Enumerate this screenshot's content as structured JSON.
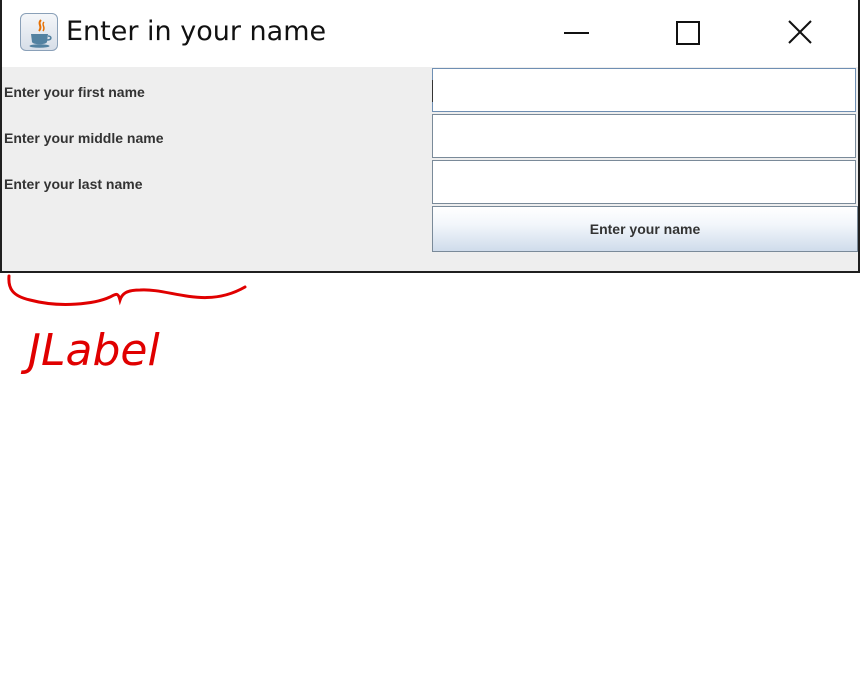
{
  "window": {
    "title": "Enter in your name",
    "app_icon": "java-coffee-icon",
    "controls": {
      "minimize_icon": "minimize-icon",
      "maximize_icon": "maximize-icon",
      "close_icon": "close-icon"
    }
  },
  "form": {
    "fields": [
      {
        "label": "Enter your first name",
        "value": ""
      },
      {
        "label": "Enter your middle name",
        "value": ""
      },
      {
        "label": "Enter your last name",
        "value": ""
      }
    ],
    "submit_label": "Enter your name"
  },
  "annotation": {
    "text": "JLabel",
    "color": "#e00000"
  },
  "colors": {
    "panel_bg": "#eeeeee",
    "field_border": "#7a8a99",
    "button_gradient_bottom": "#cfdceb"
  }
}
